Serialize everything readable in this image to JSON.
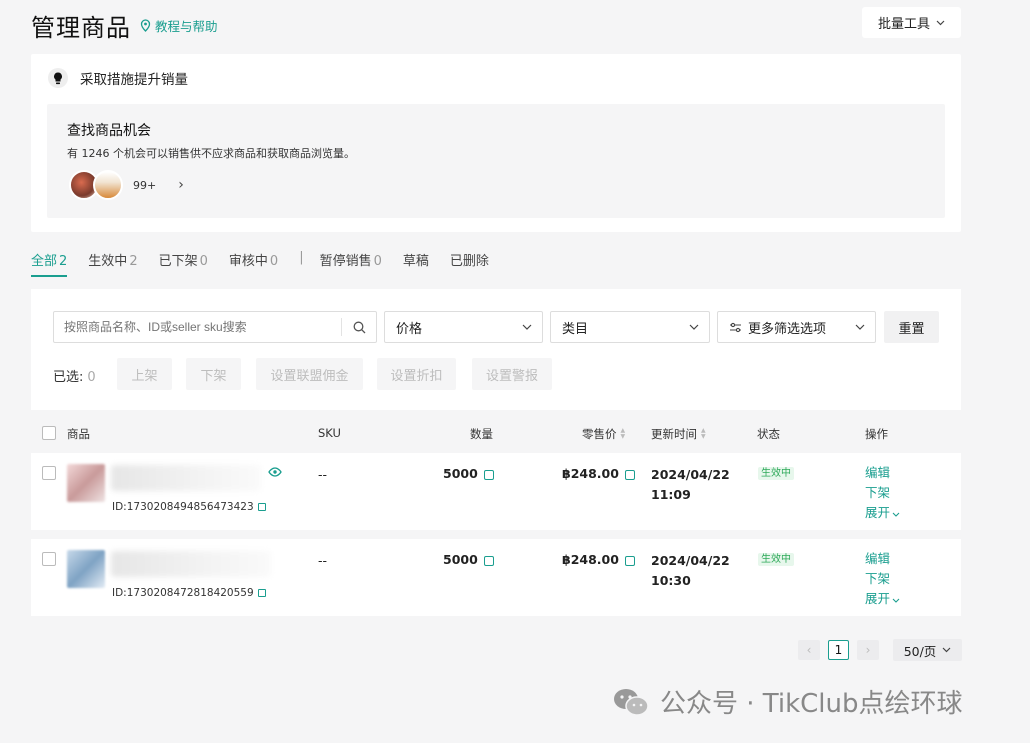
{
  "header": {
    "title": "管理商品",
    "help_link": "教程与帮助",
    "batch_tools": "批量工具"
  },
  "opportunity": {
    "heading": "采取措施提升销量",
    "title": "查找商品机会",
    "description": "有 1246 个机会可以销售供不应求商品和获取商品浏览量。",
    "more_count": "99+"
  },
  "tabs": [
    {
      "label": "全部",
      "count": "2",
      "active": true
    },
    {
      "label": "生效中",
      "count": "2"
    },
    {
      "label": "已下架",
      "count": "0"
    },
    {
      "label": "审核中",
      "count": "0"
    },
    {
      "label": "暂停销售",
      "count": "0"
    },
    {
      "label": "草稿",
      "count": ""
    },
    {
      "label": "已删除",
      "count": ""
    }
  ],
  "filters": {
    "search_placeholder": "按照商品名称、ID或seller sku搜索",
    "price": "价格",
    "category": "类目",
    "more": "更多筛选选项",
    "reset": "重置"
  },
  "bulk": {
    "selected_label": "已选:",
    "selected_count": "0",
    "list": "上架",
    "delist": "下架",
    "affiliate": "设置联盟佣金",
    "discount": "设置折扣",
    "alert": "设置警报"
  },
  "table": {
    "headers": {
      "product": "商品",
      "sku": "SKU",
      "quantity": "数量",
      "price": "零售价",
      "updated": "更新时间",
      "status": "状态",
      "actions": "操作"
    },
    "rows": [
      {
        "id": "ID:1730208494856473423",
        "sku": "--",
        "quantity": "5000",
        "price": "฿248.00",
        "date": "2024/04/22",
        "time": "11:09",
        "status": "生效中",
        "edit": "编辑",
        "delist": "下架",
        "expand": "展开"
      },
      {
        "id": "ID:1730208472818420559",
        "sku": "--",
        "quantity": "5000",
        "price": "฿248.00",
        "date": "2024/04/22",
        "time": "10:30",
        "status": "生效中",
        "edit": "编辑",
        "delist": "下架",
        "expand": "展开"
      }
    ]
  },
  "pagination": {
    "current": "1",
    "page_size": "50/页"
  },
  "watermark": "公众号 · TikClub点绘环球",
  "colors": {
    "accent": "#1a9e8f",
    "status_green": "#2faa5a",
    "background": "#f5f5f6"
  }
}
